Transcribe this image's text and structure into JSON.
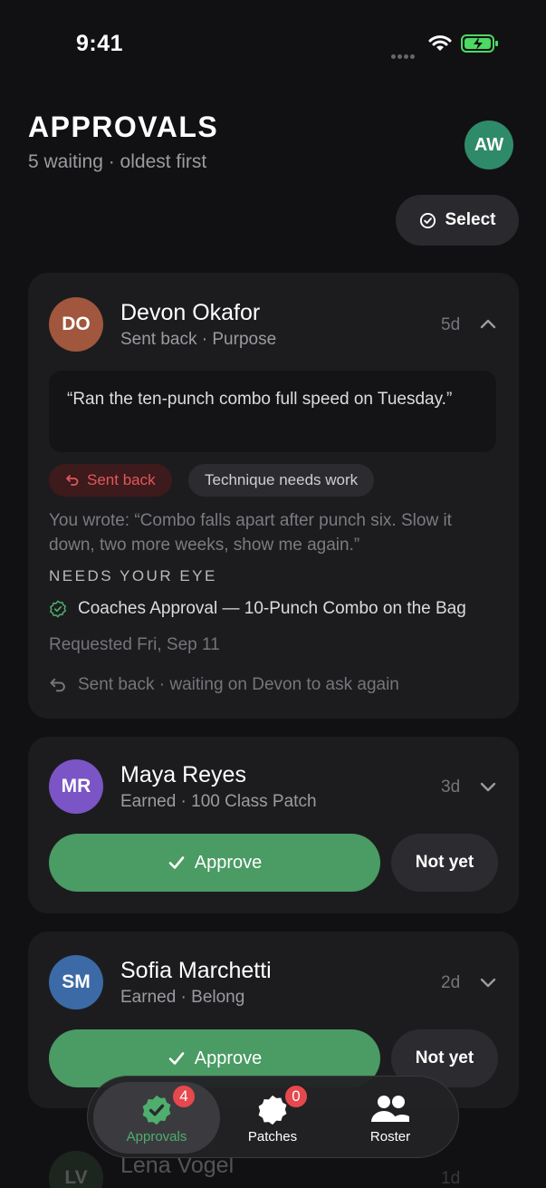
{
  "status": {
    "time": "9:41"
  },
  "header": {
    "title": "APPROVALS",
    "subtitle": "5 waiting · oldest first",
    "user_initials": "AW",
    "select_label": "Select"
  },
  "cards": [
    {
      "initials": "DO",
      "name": "Devon Okafor",
      "meta": "Sent back · Purpose",
      "age": "5d",
      "avatar_color": "#a0573d",
      "quote": "“Ran the ten-punch combo full speed on Tuesday.”",
      "chip_status": "Sent back",
      "chip_reason": "Technique needs work",
      "you_wrote": "You wrote: “Combo falls apart after punch six. Slow it down, two more weeks, show me again.”",
      "section_label": "NEEDS YOUR EYE",
      "requirement": "Coaches Approval — 10-Punch Combo on the Bag",
      "requested": "Requested Fri, Sep 11",
      "footer": "Sent back · waiting on Devon to ask again"
    },
    {
      "initials": "MR",
      "name": "Maya Reyes",
      "meta": "Earned · 100 Class Patch",
      "age": "3d",
      "avatar_color": "#7b55c5",
      "approve_label": "Approve",
      "notyet_label": "Not yet"
    },
    {
      "initials": "SM",
      "name": "Sofia Marchetti",
      "meta": "Earned · Belong",
      "age": "2d",
      "avatar_color": "#3b6aa6",
      "approve_label": "Approve",
      "notyet_label": "Not yet"
    },
    {
      "initials": "LV",
      "name": "Lena Vogel",
      "age": "1d"
    }
  ],
  "tabbar": [
    {
      "label": "Approvals",
      "icon": "badge-check-icon",
      "badge": "4",
      "active": true
    },
    {
      "label": "Patches",
      "icon": "patch-icon",
      "badge": "0",
      "active": false
    },
    {
      "label": "Roster",
      "icon": "people-icon",
      "active": false
    }
  ],
  "colors": {
    "accent_green": "#4a9b64",
    "danger": "#e5484d",
    "background": "#111113",
    "card": "#1c1c1f"
  }
}
